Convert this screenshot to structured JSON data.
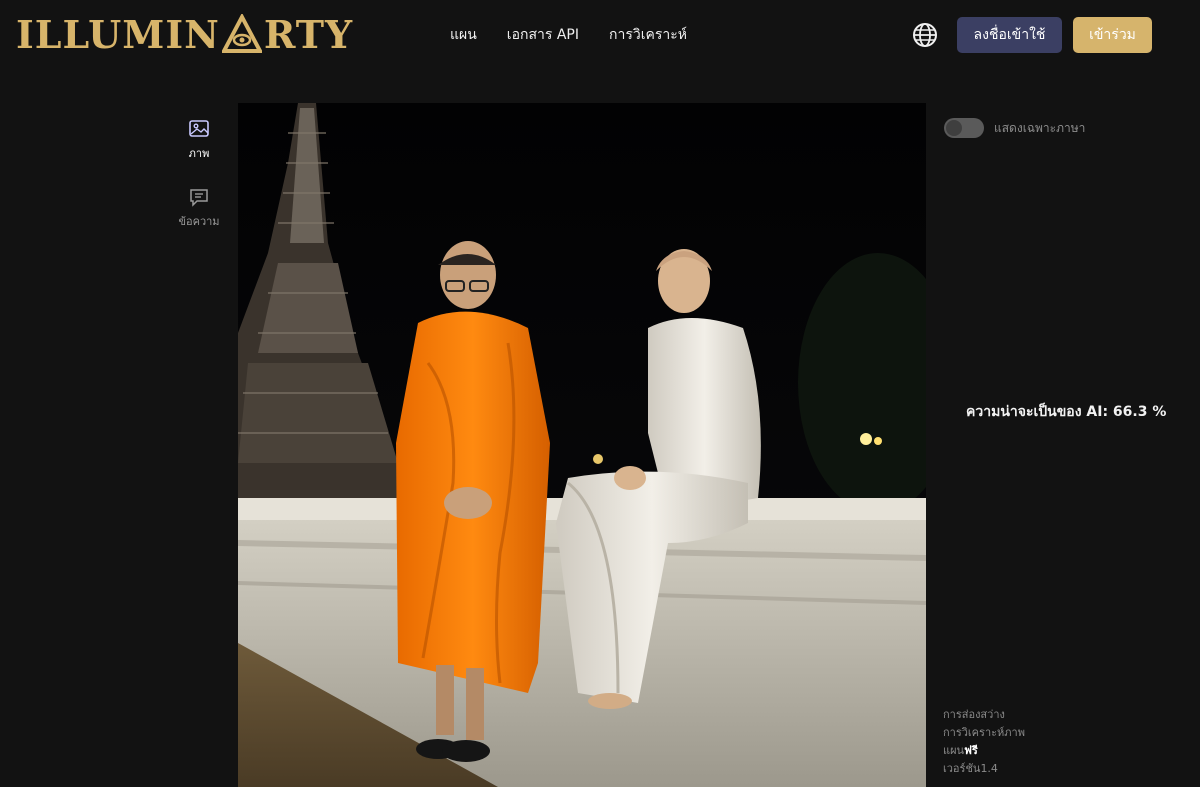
{
  "header": {
    "logo": "ILLUMINARTY",
    "nav": [
      "แผน",
      "เอกสาร API",
      "การวิเคราะห์"
    ],
    "login_label": "ลงชื่อเข้าใช้",
    "join_label": "เข้าร่วม"
  },
  "sidebar": {
    "tabs": [
      {
        "label": "ภาพ",
        "icon": "image-icon",
        "active": true
      },
      {
        "label": "ข้อความ",
        "icon": "chat-icon",
        "active": false
      }
    ]
  },
  "panel": {
    "toggle_label": "แสดงเฉพาะภาษา",
    "toggle_on": false,
    "ai_probability_text": "ความน่าจะเป็นของ AI: 66.3 %",
    "ai_probability": 66.3,
    "footer": {
      "line1": "การส่องสว่าง",
      "line2": "การวิเคราะห์ภาพ",
      "plan_label": "แผน",
      "plan_value": "ฟรี",
      "version_label": "เวอร์ชัน",
      "version_value": "1.4"
    }
  },
  "colors": {
    "background": "#121212",
    "brand_gold": "#d7b46a",
    "login_button": "#3b3f63",
    "join_button": "#d6b46c"
  }
}
